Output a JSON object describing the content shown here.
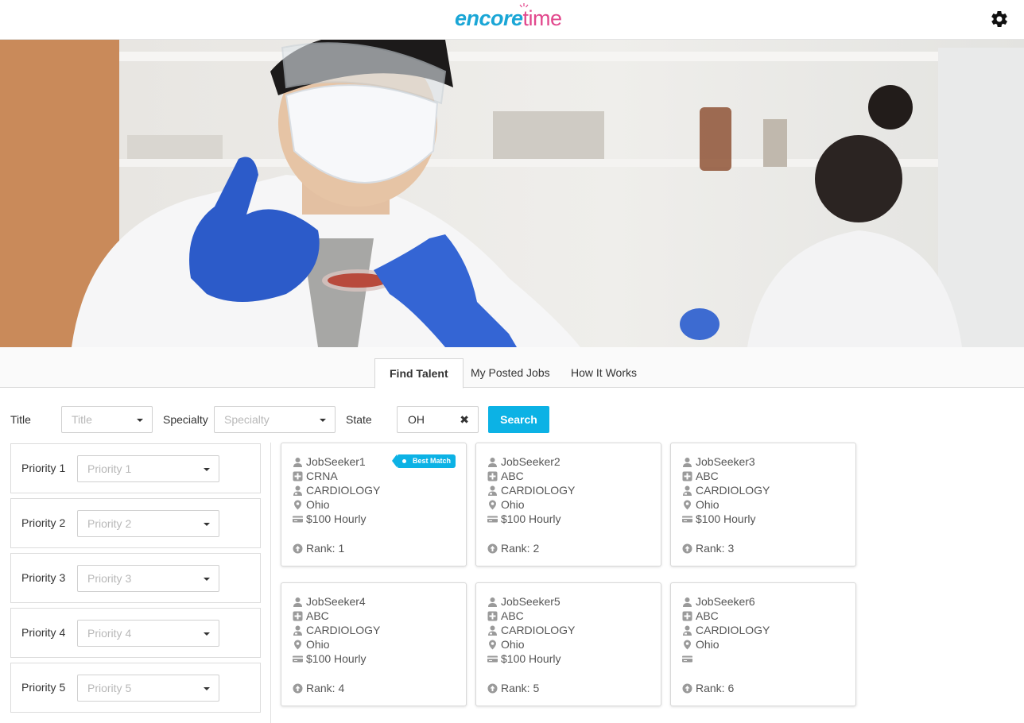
{
  "app": {
    "logo_part1": "encore",
    "logo_part2": "time",
    "settings_icon": "gear-icon"
  },
  "tabs": [
    {
      "label": "Find Talent",
      "active": true
    },
    {
      "label": "My Posted Jobs",
      "active": false
    },
    {
      "label": "How It Works",
      "active": false
    }
  ],
  "filters": {
    "title_label": "Title",
    "title_placeholder": "Title",
    "specialty_label": "Specialty",
    "specialty_placeholder": "Specialty",
    "state_label": "State",
    "state_value": "OH",
    "search_label": "Search"
  },
  "priorities": [
    {
      "label": "Priority 1",
      "placeholder": "Priority 1"
    },
    {
      "label": "Priority 2",
      "placeholder": "Priority 2"
    },
    {
      "label": "Priority 3",
      "placeholder": "Priority 3"
    },
    {
      "label": "Priority 4",
      "placeholder": "Priority 4"
    },
    {
      "label": "Priority 5",
      "placeholder": "Priority 5"
    }
  ],
  "cards": [
    {
      "name": "JobSeeker1",
      "title": "CRNA",
      "specialty": "CARDIOLOGY",
      "location": "Ohio",
      "rate": "$100 Hourly",
      "rank": "Rank: 1",
      "badge": "Best Match"
    },
    {
      "name": "JobSeeker2",
      "title": "ABC",
      "specialty": "CARDIOLOGY",
      "location": "Ohio",
      "rate": "$100 Hourly",
      "rank": "Rank: 2",
      "badge": ""
    },
    {
      "name": "JobSeeker3",
      "title": "ABC",
      "specialty": "CARDIOLOGY",
      "location": "Ohio",
      "rate": "$100 Hourly",
      "rank": "Rank: 3",
      "badge": ""
    },
    {
      "name": "JobSeeker4",
      "title": "ABC",
      "specialty": "CARDIOLOGY",
      "location": "Ohio",
      "rate": "$100 Hourly",
      "rank": "Rank: 4",
      "badge": ""
    },
    {
      "name": "JobSeeker5",
      "title": "ABC",
      "specialty": "CARDIOLOGY",
      "location": "Ohio",
      "rate": "$100 Hourly",
      "rank": "Rank: 5",
      "badge": ""
    },
    {
      "name": "JobSeeker6",
      "title": "ABC",
      "specialty": "CARDIOLOGY",
      "location": "Ohio",
      "rate": "",
      "rank": "Rank: 6",
      "badge": ""
    }
  ],
  "colors": {
    "accent": "#0cb2e5",
    "logo_blue": "#1aa6d6",
    "logo_pink": "#e2488d"
  }
}
